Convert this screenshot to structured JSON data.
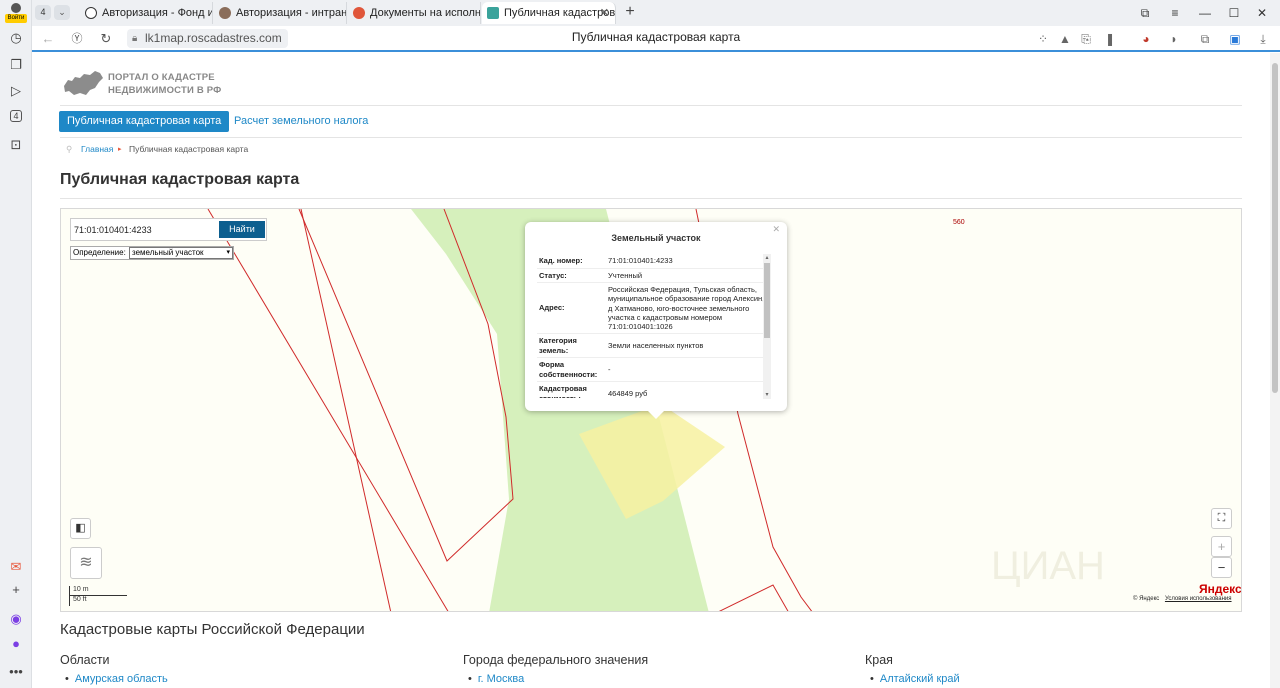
{
  "browser": {
    "login_label": "Войти",
    "tab_count": "4",
    "tabs": [
      {
        "title": "Авторизация - Фонд иму",
        "icon_color": "#333333"
      },
      {
        "title": "Авторизация - интранет",
        "icon_color": "#8a6d5a"
      },
      {
        "title": "Документы на исполнен",
        "icon_color": "#e0563a"
      },
      {
        "title": "Публичная кадастровая",
        "icon_color": "#3aa39b"
      }
    ],
    "url": "lk1map.roscadastres.com",
    "page_title": "Публичная кадастровая карта",
    "side_badge": "4"
  },
  "site": {
    "logo_line1": "ПОРТАЛ О КАДАСТРЕ",
    "logo_line2": "НЕДВИЖИМОСТИ В РФ",
    "nav_active": "Публичная кадастровая карта",
    "nav_link": "Расчет земельного налога",
    "breadcrumb_home": "Главная",
    "breadcrumb_current": "Публичная кадастровая карта",
    "heading": "Публичная кадастровая карта"
  },
  "map": {
    "search_value": "71:01:010401:4233",
    "search_button": "Найти",
    "definition_label": "Определение:",
    "definition_value": "земельный участок",
    "label_560": "560",
    "scale_m": "10 m",
    "scale_ft": "50 ft",
    "yandex_logo": "Яндекс",
    "attribution": "© Яндекс",
    "terms": "Условия использования",
    "zoom_in": "+",
    "zoom_out": "−",
    "popup": {
      "title": "Земельный участок",
      "rows": [
        {
          "k": "Кад. номер:",
          "v": "71:01:010401:4233"
        },
        {
          "k": "Статус:",
          "v": "Учтенный"
        },
        {
          "k": "Адрес:",
          "v": "Российская Федерация, Тульская область, муниципальное образование город Алексин, д Хатманово, юго-восточнее земельного участка с кадастровым номером 71:01:010401:1026"
        },
        {
          "k": "Категория земель:",
          "v": "Земли населенных пунктов"
        },
        {
          "k": "Форма собственности:",
          "v": "-"
        },
        {
          "k": "Кадастровая стоимость:",
          "v": "464849 руб"
        }
      ]
    }
  },
  "bottom": {
    "heading": "Кадастровые карты Российской Федерации",
    "col1_title": "Области",
    "col1_item": "Амурская область",
    "col2_title": "Города федерального значения",
    "col2_item": "г. Москва",
    "col3_title": "Края",
    "col3_item": "Алтайский край"
  }
}
